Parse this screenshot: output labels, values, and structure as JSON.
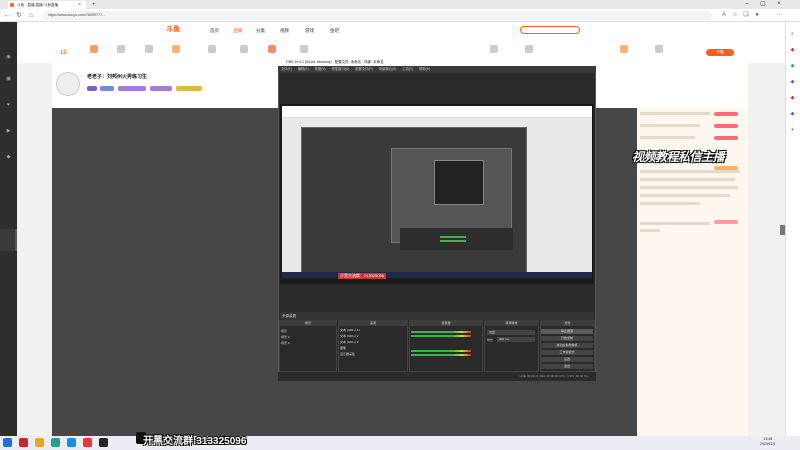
{
  "browser": {
    "tab_title": "斗鱼 - 直播 直播 斗鱼直播",
    "url": "https://www.douyu.com/7605977?... "
  },
  "site": {
    "logo": "斗鱼",
    "nav": [
      "首页",
      "直播",
      "分类",
      "视频",
      "游戏",
      "鱼吧"
    ],
    "level": "12",
    "open_button": "开播"
  },
  "streamer": {
    "title": "老老子：刘邦州火男练习生",
    "subtitle": "...",
    "tags": [
      "",
      "",
      "",
      ""
    ]
  },
  "obs": {
    "title": "OBS 29.0.2 (64-bit, windows) - 配置文件: 未命名 - 场景: 未命名",
    "menu": [
      "文件(F)",
      "编辑(E)",
      "视图(V)",
      "停靠窗口(D)",
      "配置文件(P)",
      "场景集合(S)",
      "工具(T)",
      "帮助(H)"
    ],
    "inner_label": "开黑交流群：313325096",
    "scene_bar": "来源装置",
    "docks": [
      "场景",
      "来源",
      "混音器",
      "转场特效",
      "控件"
    ],
    "scenes": [
      "场景",
      "场景 2",
      "场景 3"
    ],
    "sources": [
      "文本 (GDI+) 11",
      "文本 (GDI+) 2",
      "文本 (GDI+) 3",
      "图像",
      "显示器采集"
    ],
    "transition": [
      "淡出",
      "时长",
      "300 ms"
    ],
    "controls": [
      "停止推流",
      "开始录制",
      "启动虚拟摄像机",
      "工作室模式",
      "设置",
      "退出"
    ],
    "status": "LIVE 00:01:21   REC 00:00:00   CPU: 1.9%, 60.00 fps"
  },
  "overlay_text": "视频教程私信主播",
  "group_text": "开黑交流群:313325096",
  "clock": {
    "time": "13:48",
    "date": "2023/12/1"
  }
}
